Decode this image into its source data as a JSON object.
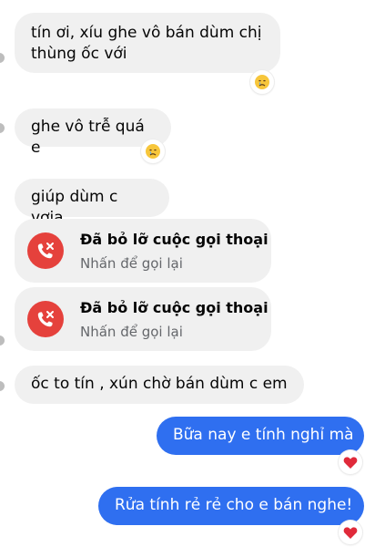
{
  "messages": [
    {
      "text_line1": "tín ơi, xíu ghe vô bán dùm chị",
      "text_line2": "thùng ốc với",
      "reaction": "crying-face"
    },
    {
      "text": "ghe vô trễ quá e",
      "reaction": "crying-face"
    },
    {
      "text": "giúp dùm c vơia"
    },
    {
      "text": "ốc to tín , xún chờ bán dùm c em"
    },
    {
      "text": "Bữa nay e tính nghỉ mà",
      "reaction": "red-heart"
    },
    {
      "text": "Rửa tính rẻ rẻ cho e bán nghe!",
      "reaction": "red-heart"
    }
  ],
  "calls": [
    {
      "title": "Đã bỏ lỡ cuộc gọi thoại",
      "subtitle": "Nhấn để gọi lại"
    },
    {
      "title": "Đã bỏ lỡ cuộc gọi thoại",
      "subtitle": "Nhấn để gọi lại"
    }
  ],
  "colors": {
    "incoming_bg": "#f0f0f0",
    "outgoing_bg": "#2f6ff0",
    "missed_call_red": "#e5413c",
    "heart": "#e02a3a"
  }
}
